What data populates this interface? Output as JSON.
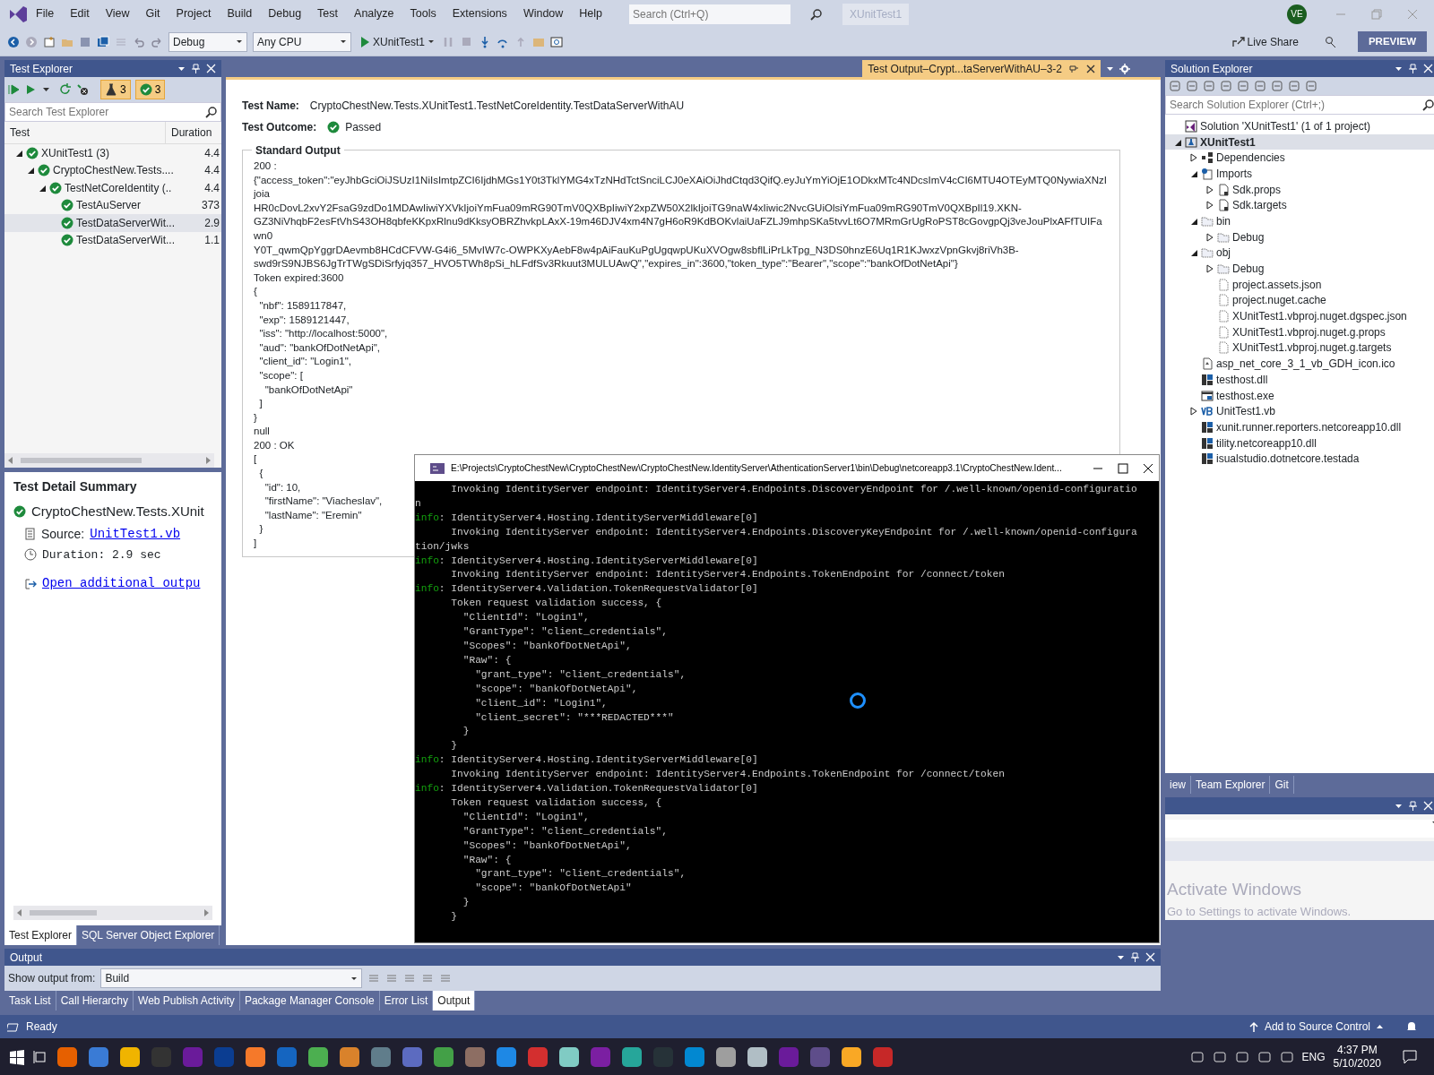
{
  "menu_bar": {
    "items": [
      "File",
      "Edit",
      "View",
      "Git",
      "Project",
      "Build",
      "Debug",
      "Test",
      "Analyze",
      "Tools",
      "Extensions",
      "Window",
      "Help"
    ],
    "search": {
      "placeholder": "Search (Ctrl+Q)"
    },
    "solution_name": "XUnitTest1",
    "avatar": "VE"
  },
  "toolbar": {
    "configuration": "Debug",
    "platform": "Any CPU",
    "start_target": "XUnitTest1",
    "live_share": "Live Share",
    "preview": "PREVIEW"
  },
  "test_explorer": {
    "title": "Test Explorer",
    "filters": [
      {
        "kind": "total",
        "count": "3"
      },
      {
        "kind": "passed",
        "count": "3"
      }
    ],
    "search": {
      "placeholder": "Search Test Explorer"
    },
    "columns": [
      "Test",
      "Duration"
    ],
    "tree": [
      {
        "name": "XUnitTest1 (3)",
        "duration": "4.4",
        "expanded": true,
        "selected": false,
        "children": [
          {
            "name": "CryptoChestNew.Tests....",
            "duration": "4.4",
            "expanded": true,
            "selected": false,
            "children": [
              {
                "name": "TestNetCoreIdentity (..",
                "duration": "4.4",
                "expanded": true,
                "selected": false,
                "children": [
                  {
                    "name": "TestAuServer",
                    "duration": "373",
                    "selected": false
                  },
                  {
                    "name": "TestDataServerWit...",
                    "duration": "2.9",
                    "selected": true
                  },
                  {
                    "name": "TestDataServerWit...",
                    "duration": "1.1",
                    "selected": false
                  }
                ]
              }
            ]
          }
        ]
      }
    ]
  },
  "test_detail": {
    "title": "Test Detail Summary",
    "test": "CryptoChestNew.Tests.XUnit",
    "source_label": "Source:",
    "source_link": "UnitTest1.vb",
    "duration": "Duration: 2.9 sec",
    "additional_link": "Open additional outpu"
  },
  "left_tabs": [
    {
      "label": "Test Explorer",
      "selected": true
    },
    {
      "label": "SQL Server Object Explorer",
      "selected": false
    }
  ],
  "document": {
    "tab": "Test Output–Crypt...taServerWithAU–3-2",
    "test_name_label": "Test Name:",
    "test_name": "CryptoChestNew.Tests.XUnitTest1.TestNetCoreIdentity.TestDataServerWithAU",
    "outcome_label": "Test Outcome:",
    "outcome": "Passed",
    "output_title": "Standard Output",
    "output_lines": [
      "200 :",
      "{\"access_token\":\"eyJhbGciOiJSUzI1NiIsImtpZCI6IjdhMGs1Y0t3TklYMG4xTzNHdTctSnciLCJ0eXAiOiJhdCtqd3QifQ.eyJuYmYiOjE1ODkxMTc4NDcsImV4cCI6MTU4OTEyMTQ0NywiaXNzIjoia",
      "HR0cDovL2xvY2FsaG9zdDo1MDAwIiwiYXVkIjoiYmFua09mRG90TmV0QXBpIiwiY2xpZW50X2lkIjoiTG9naW4xIiwic2NvcGUiOlsiYmFua09mRG90TmV0QXBpIl19.XKN-",
      "GZ3NiVhqbF2esFtVhS43OH8qbfeKKpxRlnu9dKksyOBRZhvkpLAxX-19m46DJV4xm4N7gH6oR9KdBOKvlaiUaFZLJ9mhpSKa5tvvLt6O7MRmGrUgRoPST8cGovgpQj3veJouPlxAFfTUIFawn0",
      "Y0T_qwmQpYggrDAevmb8HCdCFVW-G4i6_5MvIW7c-OWPKXyAebF8w4pAiFauKuPgUgqwpUKuXVOgw8sbflLiPrLkTpg_N3DS0hnzE6Uq1R1KJwxzVpnGkvj8riVh3B-",
      "swd9rS9NJBS6JgTrTWgSDiSrfyjq357_HVO5TWh8pSi_hLFdfSv3Rkuut3MULUAwQ\",\"expires_in\":3600,\"token_type\":\"Bearer\",\"scope\":\"bankOfDotNetApi\"}",
      "Token expired:3600",
      "{",
      "  \"nbf\": 1589117847,",
      "  \"exp\": 1589121447,",
      "  \"iss\": \"http://localhost:5000\",",
      "  \"aud\": \"bankOfDotNetApi\",",
      "  \"client_id\": \"Login1\",",
      "  \"scope\": [",
      "    \"bankOfDotNetApi\"",
      "  ]",
      "}",
      "null",
      "200 : OK",
      "[",
      "  {",
      "    \"id\": 10,",
      "    \"firstName\": \"Viacheslav\",",
      "    \"lastName\": \"Eremin\"",
      "  }",
      "]"
    ]
  },
  "console": {
    "title": "E:\\Projects\\CryptoChestNew\\CryptoChestNew\\CryptoChestNew.IdentityServer\\AthenticationServer1\\bin\\Debug\\netcoreapp3.1\\CryptoChestNew.Ident...",
    "lines": [
      {
        "text": "      Invoking IdentityServer endpoint: IdentityServer4.Endpoints.DiscoveryEndpoint for /.well-known/openid-configuratio"
      },
      {
        "text": "n"
      },
      {
        "tag": "info",
        "text": ": IdentityServer4.Hosting.IdentityServerMiddleware[0]"
      },
      {
        "text": "      Invoking IdentityServer endpoint: IdentityServer4.Endpoints.DiscoveryKeyEndpoint for /.well-known/openid-configura"
      },
      {
        "text": "tion/jwks"
      },
      {
        "tag": "info",
        "text": ": IdentityServer4.Hosting.IdentityServerMiddleware[0]"
      },
      {
        "text": "      Invoking IdentityServer endpoint: IdentityServer4.Endpoints.TokenEndpoint for /connect/token"
      },
      {
        "tag": "info",
        "text": ": IdentityServer4.Validation.TokenRequestValidator[0]"
      },
      {
        "text": "      Token request validation success, {"
      },
      {
        "text": "        \"ClientId\": \"Login1\","
      },
      {
        "text": "        \"GrantType\": \"client_credentials\","
      },
      {
        "text": "        \"Scopes\": \"bankOfDotNetApi\","
      },
      {
        "text": "        \"Raw\": {"
      },
      {
        "text": "          \"grant_type\": \"client_credentials\","
      },
      {
        "text": "          \"scope\": \"bankOfDotNetApi\","
      },
      {
        "text": "          \"client_id\": \"Login1\","
      },
      {
        "text": "          \"client_secret\": \"***REDACTED***\""
      },
      {
        "text": "        }"
      },
      {
        "text": "      }"
      },
      {
        "tag": "info",
        "text": ": IdentityServer4.Hosting.IdentityServerMiddleware[0]"
      },
      {
        "text": "      Invoking IdentityServer endpoint: IdentityServer4.Endpoints.TokenEndpoint for /connect/token"
      },
      {
        "tag": "info",
        "text": ": IdentityServer4.Validation.TokenRequestValidator[0]"
      },
      {
        "text": "      Token request validation success, {"
      },
      {
        "text": "        \"ClientId\": \"Login1\","
      },
      {
        "text": "        \"GrantType\": \"client_credentials\","
      },
      {
        "text": "        \"Scopes\": \"bankOfDotNetApi\","
      },
      {
        "text": "        \"Raw\": {"
      },
      {
        "text": "          \"grant_type\": \"client_credentials\","
      },
      {
        "text": "          \"scope\": \"bankOfDotNetApi\""
      },
      {
        "text": "        }"
      },
      {
        "text": "      }"
      }
    ]
  },
  "solution_explorer": {
    "title": "Solution Explorer",
    "search": {
      "placeholder": "Search Solution Explorer (Ctrl+;)"
    },
    "tree": [
      {
        "name": "Solution 'XUnitTest1' (1 of 1 project)",
        "kind": "solution",
        "selected": false,
        "children": [
          {
            "name": "XUnitTest1",
            "kind": "project",
            "expanded": true,
            "selected": true,
            "children": [
              {
                "name": "Dependencies",
                "kind": "deps",
                "expanded": false,
                "selected": false
              },
              {
                "name": "Imports",
                "kind": "imports",
                "expanded": true,
                "selected": false,
                "children": [
                  {
                    "name": "Sdk.props",
                    "kind": "import",
                    "expanded": false,
                    "selected": false
                  },
                  {
                    "name": "Sdk.targets",
                    "kind": "import",
                    "expanded": false,
                    "selected": false
                  }
                ]
              },
              {
                "name": "bin",
                "kind": "folder",
                "expanded": true,
                "selected": false,
                "children": [
                  {
                    "name": "Debug",
                    "kind": "folder",
                    "expanded": false,
                    "selected": false
                  }
                ]
              },
              {
                "name": "obj",
                "kind": "folder",
                "expanded": true,
                "selected": false,
                "children": [
                  {
                    "name": "Debug",
                    "kind": "folder",
                    "expanded": false,
                    "selected": false
                  },
                  {
                    "name": "project.assets.json",
                    "kind": "file",
                    "selected": false
                  },
                  {
                    "name": "project.nuget.cache",
                    "kind": "file",
                    "selected": false
                  },
                  {
                    "name": "XUnitTest1.vbproj.nuget.dgspec.json",
                    "kind": "file",
                    "selected": false
                  },
                  {
                    "name": "XUnitTest1.vbproj.nuget.g.props",
                    "kind": "file",
                    "selected": false
                  },
                  {
                    "name": "XUnitTest1.vbproj.nuget.g.targets",
                    "kind": "file",
                    "selected": false
                  }
                ]
              },
              {
                "name": "asp_net_core_3_1_vb_GDH_icon.ico",
                "kind": "image",
                "selected": false
              },
              {
                "name": "testhost.dll",
                "kind": "dll",
                "selected": false
              },
              {
                "name": "testhost.exe",
                "kind": "exe",
                "selected": false
              },
              {
                "name": "UnitTest1.vb",
                "kind": "vb",
                "expanded": false,
                "selected": false
              },
              {
                "name": "xunit.runner.reporters.netcoreapp10.dll",
                "kind": "dll",
                "selected": false
              },
              {
                "name": "tility.netcoreapp10.dll",
                "kind": "dll",
                "selected": false
              },
              {
                "name": "isualstudio.dotnetcore.testada",
                "kind": "dll",
                "selected": false
              }
            ]
          }
        ]
      }
    ]
  },
  "right_tabs": [
    {
      "label": "iew",
      "selected": false
    },
    {
      "label": "Team Explorer",
      "selected": false
    },
    {
      "label": "Git",
      "selected": false
    }
  ],
  "activation": {
    "title": "Activate Windows",
    "hint": "Go to Settings to activate Windows."
  },
  "output_panel": {
    "title": "Output",
    "source_label": "Show output from:",
    "source": "Build"
  },
  "bottom_tabs": [
    {
      "label": "Task List",
      "selected": false
    },
    {
      "label": "Call Hierarchy",
      "selected": false
    },
    {
      "label": "Web Publish Activity",
      "selected": false
    },
    {
      "label": "Package Manager Console",
      "selected": false
    },
    {
      "label": "Error List",
      "selected": false
    },
    {
      "label": "Output",
      "selected": true
    }
  ],
  "status_bar": {
    "text": "Ready",
    "source_control": "Add to Source Control"
  },
  "taskbar": {
    "language": "ENG",
    "time": "4:37 PM",
    "date": "5/10/2020"
  }
}
